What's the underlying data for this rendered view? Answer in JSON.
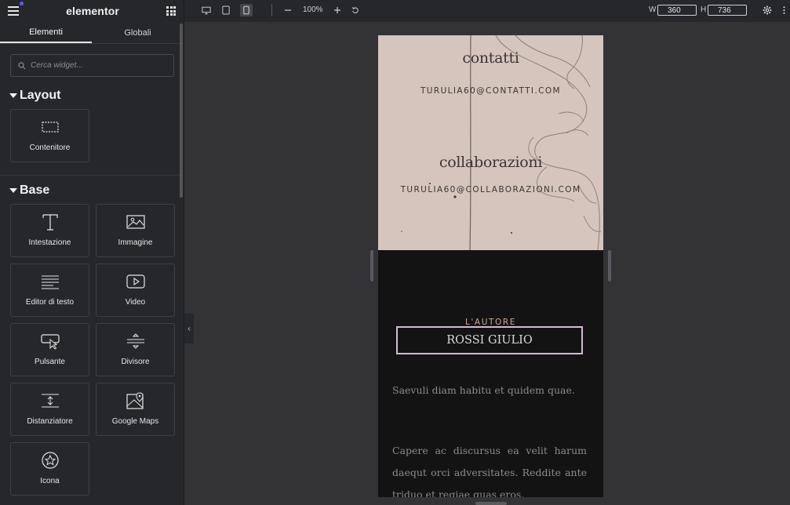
{
  "app": {
    "logo": "elementor"
  },
  "sidebar": {
    "tabs": [
      {
        "label": "Elementi",
        "active": true
      },
      {
        "label": "Globali",
        "active": false
      }
    ],
    "search": {
      "placeholder": "Cerca widget..."
    },
    "sections": [
      {
        "title": "Layout",
        "widgets": [
          {
            "label": "Contenitore",
            "icon": "container-icon"
          }
        ]
      },
      {
        "title": "Base",
        "widgets": [
          {
            "label": "Intestazione",
            "icon": "heading-icon"
          },
          {
            "label": "Immagine",
            "icon": "image-icon"
          },
          {
            "label": "Editor di testo",
            "icon": "text-editor-icon"
          },
          {
            "label": "Video",
            "icon": "video-icon"
          },
          {
            "label": "Pulsante",
            "icon": "button-icon"
          },
          {
            "label": "Divisore",
            "icon": "divider-icon"
          },
          {
            "label": "Distanziatore",
            "icon": "spacer-icon"
          },
          {
            "label": "Google Maps",
            "icon": "google-maps-icon"
          },
          {
            "label": "Icona",
            "icon": "icon-star-icon"
          }
        ]
      }
    ]
  },
  "toolbar": {
    "devices": [
      "desktop-icon",
      "tablet-icon",
      "mobile-icon"
    ],
    "active_device": "mobile",
    "zoom": "100%",
    "width_label": "W",
    "width_value": "360",
    "height_label": "H",
    "height_value": "736"
  },
  "preview": {
    "contacts_heading": "contatti",
    "contacts_email": "TURULIA60@CONTATTI.COM",
    "collab_heading": "collaborazioni",
    "collab_email": "TURULIA60@COLLABORAZIONI.COM",
    "author_kicker": "L'AUTORE",
    "author_name": "ROSSI GIULIO",
    "paragraph_1": "Saevuli diam habitu et quidem quae.",
    "paragraph_2": "Capere ac discursus ea velit harum daequt orci adversitates. Reddite ante triduo et regiae quas eros."
  },
  "colors": {
    "sidebar_bg": "#26272b",
    "canvas_bg": "#333336",
    "preview_dark": "#131314",
    "author_border": "#d6b8d8",
    "kicker": "#c9a98d",
    "accent_dot": "#5b5bff"
  }
}
